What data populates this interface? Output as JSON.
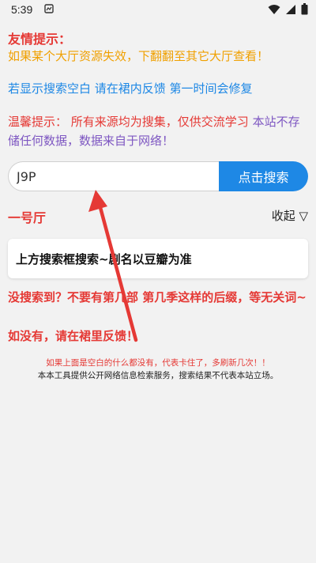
{
  "status_bar": {
    "time": "5:39",
    "icons": [
      "notification-icon",
      "wifi-icon",
      "signal-icon",
      "battery-icon"
    ]
  },
  "notices": {
    "title": "友情提示：",
    "line1": "如果某个大厅资源失效，下翻翻至其它大厅查看！",
    "line2": "若显示搜索空白 请在裙内反馈 第一时间会修复",
    "warm_prefix": "温馨提示：",
    "warm_red": "所有来源均为搜集，仅供交流学习",
    "warm_purple": "本站不存储任何数据，数据来自于网络！"
  },
  "search": {
    "value": "J9P",
    "button_label": "点击搜索"
  },
  "hall": {
    "title": "一号厅",
    "collapse_label": "收起 ▽"
  },
  "card": {
    "text": "上方搜索框搜索~剧名以豆瓣为准"
  },
  "warnings": {
    "line1": "没搜索到？不要有第几部 第几季这样的后缀，等无关词~",
    "line2": "如没有，请在裙里反馈！"
  },
  "footer": {
    "line1": "如果上面是空白的什么都没有，代表卡住了，多刷新几次！！",
    "line2": "本本工具提供公开网络信息检索服务，搜索结果不代表本站立场。"
  },
  "colors": {
    "red": "#e53935",
    "orange": "#f0a000",
    "blue": "#1e88e5",
    "purple": "#7e57c2"
  }
}
